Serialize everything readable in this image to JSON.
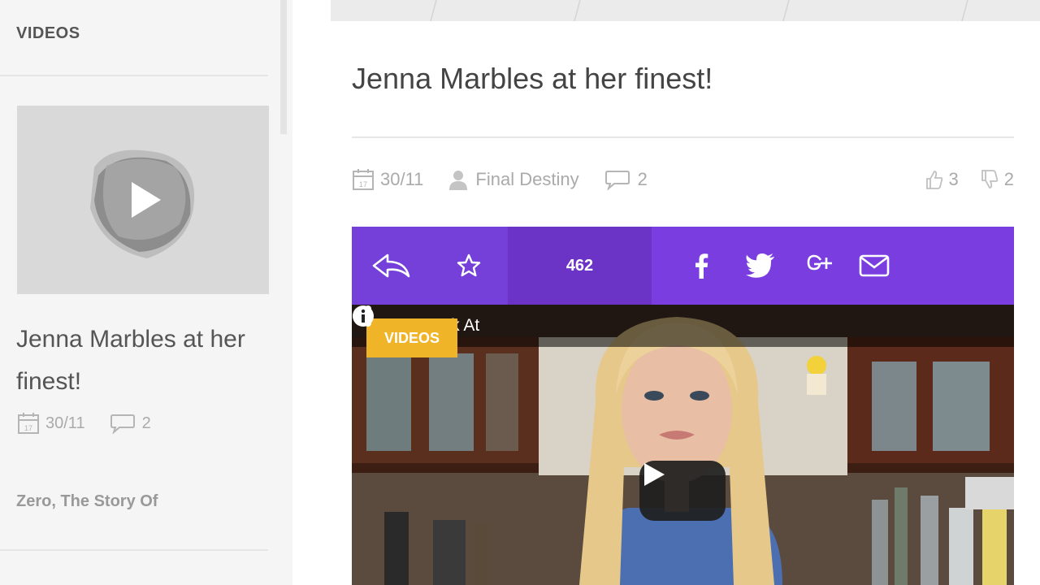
{
  "sidebar": {
    "section_title": "VIDEOS",
    "post": {
      "title": "Jenna Marbles at her finest!",
      "date": "30/11",
      "date_icon_day": "17",
      "comments": "2"
    },
    "next_post_title": "Zero, The Story Of"
  },
  "post": {
    "title": "Jenna Marbles at her finest!",
    "date": "30/11",
    "date_icon_day": "17",
    "author": "Final Destiny",
    "comments": "2",
    "likes": "3",
    "dislikes": "2"
  },
  "share_bar": {
    "count": "462",
    "background": "#7a3ee0"
  },
  "video": {
    "title": "uck At",
    "badge": "VIDEOS",
    "badge_color": "#f0b429"
  }
}
